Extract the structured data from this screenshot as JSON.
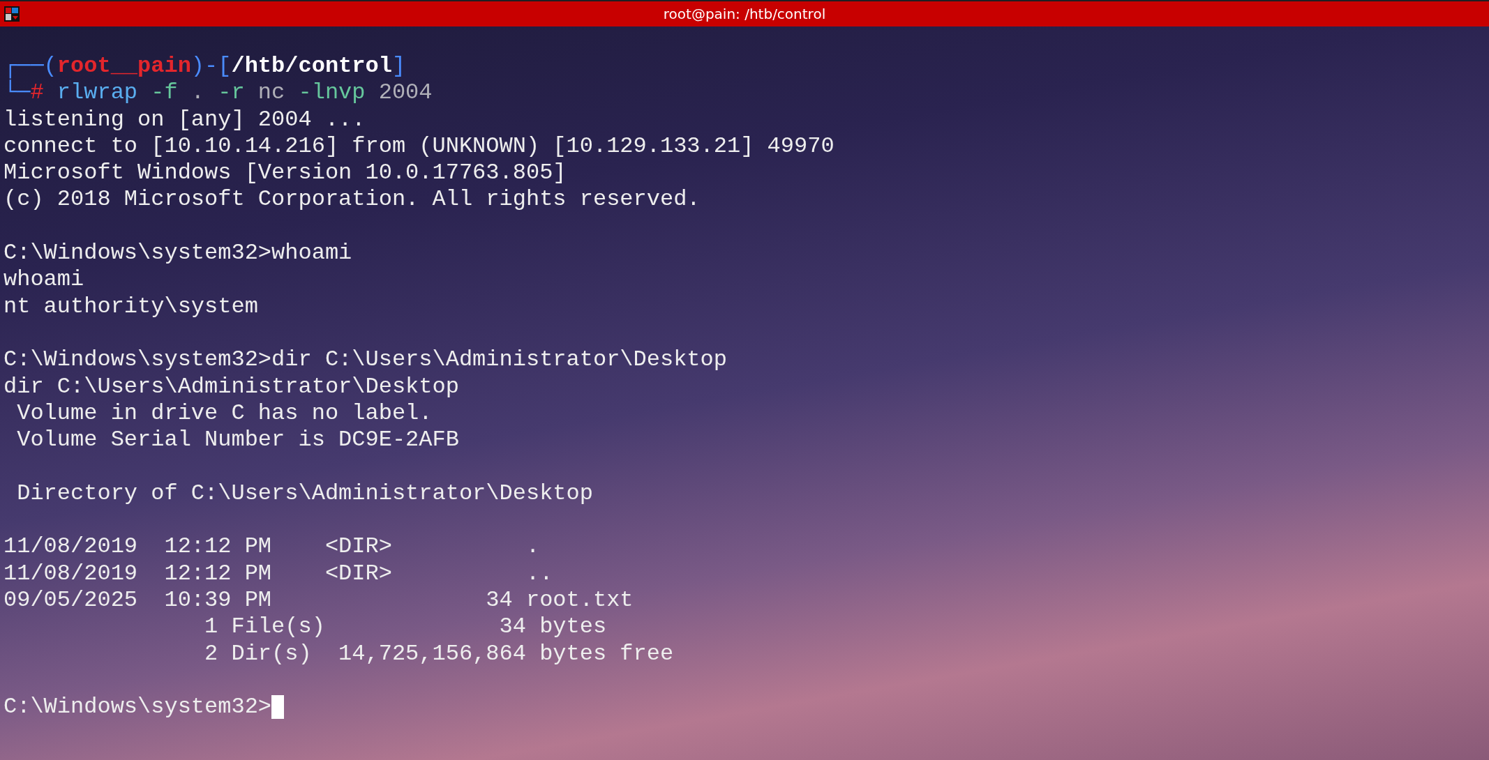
{
  "window": {
    "title": "root@pain: /htb/control"
  },
  "lines": [
    {
      "kind": "text",
      "segments": [
        {
          "kind": "frame",
          "text": "┌──("
        },
        {
          "kind": "user",
          "text": "root__pain"
        },
        {
          "kind": "frame",
          "text": ")-["
        },
        {
          "kind": "path",
          "text": "/htb/control"
        },
        {
          "kind": "frame",
          "text": "]"
        }
      ]
    },
    {
      "kind": "text",
      "segments": [
        {
          "kind": "frame",
          "text": "└─"
        },
        {
          "kind": "hash",
          "text": "# "
        },
        {
          "kind": "cmd",
          "text": "rlwrap "
        },
        {
          "kind": "arg",
          "text": "-f"
        },
        {
          "kind": "dim",
          "text": " . "
        },
        {
          "kind": "arg",
          "text": "-r"
        },
        {
          "kind": "dim",
          "text": " nc "
        },
        {
          "kind": "arg",
          "text": "-lnvp"
        },
        {
          "kind": "dim",
          "text": " 2004"
        }
      ]
    },
    {
      "kind": "text",
      "segments": [
        {
          "kind": "plain",
          "text": "listening on [any] 2004 ..."
        }
      ]
    },
    {
      "kind": "text",
      "segments": [
        {
          "kind": "plain",
          "text": "connect to [10.10.14.216] from (UNKNOWN) [10.129.133.21] 49970"
        }
      ]
    },
    {
      "kind": "text",
      "segments": [
        {
          "kind": "plain",
          "text": "Microsoft Windows [Version 10.0.17763.805]"
        }
      ]
    },
    {
      "kind": "text",
      "segments": [
        {
          "kind": "plain",
          "text": "(c) 2018 Microsoft Corporation. All rights reserved."
        }
      ]
    },
    {
      "kind": "blank"
    },
    {
      "kind": "text",
      "segments": [
        {
          "kind": "plain",
          "text": "C:\\Windows\\system32>whoami"
        }
      ]
    },
    {
      "kind": "text",
      "segments": [
        {
          "kind": "plain",
          "text": "whoami"
        }
      ]
    },
    {
      "kind": "text",
      "segments": [
        {
          "kind": "plain",
          "text": "nt authority\\system"
        }
      ]
    },
    {
      "kind": "blank"
    },
    {
      "kind": "text",
      "segments": [
        {
          "kind": "plain",
          "text": "C:\\Windows\\system32>dir C:\\Users\\Administrator\\Desktop"
        }
      ]
    },
    {
      "kind": "text",
      "segments": [
        {
          "kind": "plain",
          "text": "dir C:\\Users\\Administrator\\Desktop"
        }
      ]
    },
    {
      "kind": "text",
      "segments": [
        {
          "kind": "plain",
          "text": " Volume in drive C has no label."
        }
      ]
    },
    {
      "kind": "text",
      "segments": [
        {
          "kind": "plain",
          "text": " Volume Serial Number is DC9E-2AFB"
        }
      ]
    },
    {
      "kind": "blank"
    },
    {
      "kind": "text",
      "segments": [
        {
          "kind": "plain",
          "text": " Directory of C:\\Users\\Administrator\\Desktop"
        }
      ]
    },
    {
      "kind": "blank"
    },
    {
      "kind": "text",
      "segments": [
        {
          "kind": "plain",
          "text": "11/08/2019  12:12 PM    <DIR>          ."
        }
      ]
    },
    {
      "kind": "text",
      "segments": [
        {
          "kind": "plain",
          "text": "11/08/2019  12:12 PM    <DIR>          .."
        }
      ]
    },
    {
      "kind": "text",
      "segments": [
        {
          "kind": "plain",
          "text": "09/05/2025  10:39 PM                34 root.txt"
        }
      ]
    },
    {
      "kind": "text",
      "segments": [
        {
          "kind": "plain",
          "text": "               1 File(s)             34 bytes"
        }
      ]
    },
    {
      "kind": "text",
      "segments": [
        {
          "kind": "plain",
          "text": "               2 Dir(s)  14,725,156,864 bytes free"
        }
      ]
    },
    {
      "kind": "blank"
    },
    {
      "kind": "input",
      "segments": [
        {
          "kind": "plain",
          "text": "C:\\Windows\\system32>"
        }
      ]
    }
  ]
}
